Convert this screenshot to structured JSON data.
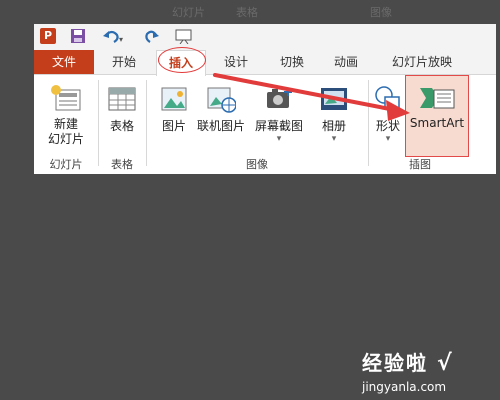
{
  "ghost_tabs": [
    "幻灯片",
    "表格",
    "图像"
  ],
  "tabs": [
    "文件",
    "开始",
    "插入",
    "设计",
    "切换",
    "动画",
    "幻灯片放映"
  ],
  "groups": {
    "slides": {
      "label": "幻灯片",
      "button": "新建\n幻灯片"
    },
    "tables": {
      "label": "表格",
      "button": "表格"
    },
    "images": {
      "label": "图像",
      "buttons": [
        "图片",
        "联机图片",
        "屏幕截图",
        "相册"
      ]
    },
    "illustrations": {
      "label": "插图",
      "buttons": [
        "形状",
        "SmartArt"
      ]
    }
  },
  "watermark": {
    "text": "经验啦",
    "check": "√",
    "url": "jingyanla.com"
  },
  "colors": {
    "accent": "#c43e1c",
    "highlight": "#e23b3b",
    "smartart_bg": "#f8dbd0"
  },
  "icons": [
    "powerpoint-icon",
    "save-icon",
    "undo-icon",
    "redo-icon",
    "slideshow-icon",
    "new-slide-icon",
    "table-icon",
    "picture-icon",
    "online-picture-icon",
    "screenshot-icon",
    "album-icon",
    "shapes-icon",
    "smartart-icon"
  ]
}
